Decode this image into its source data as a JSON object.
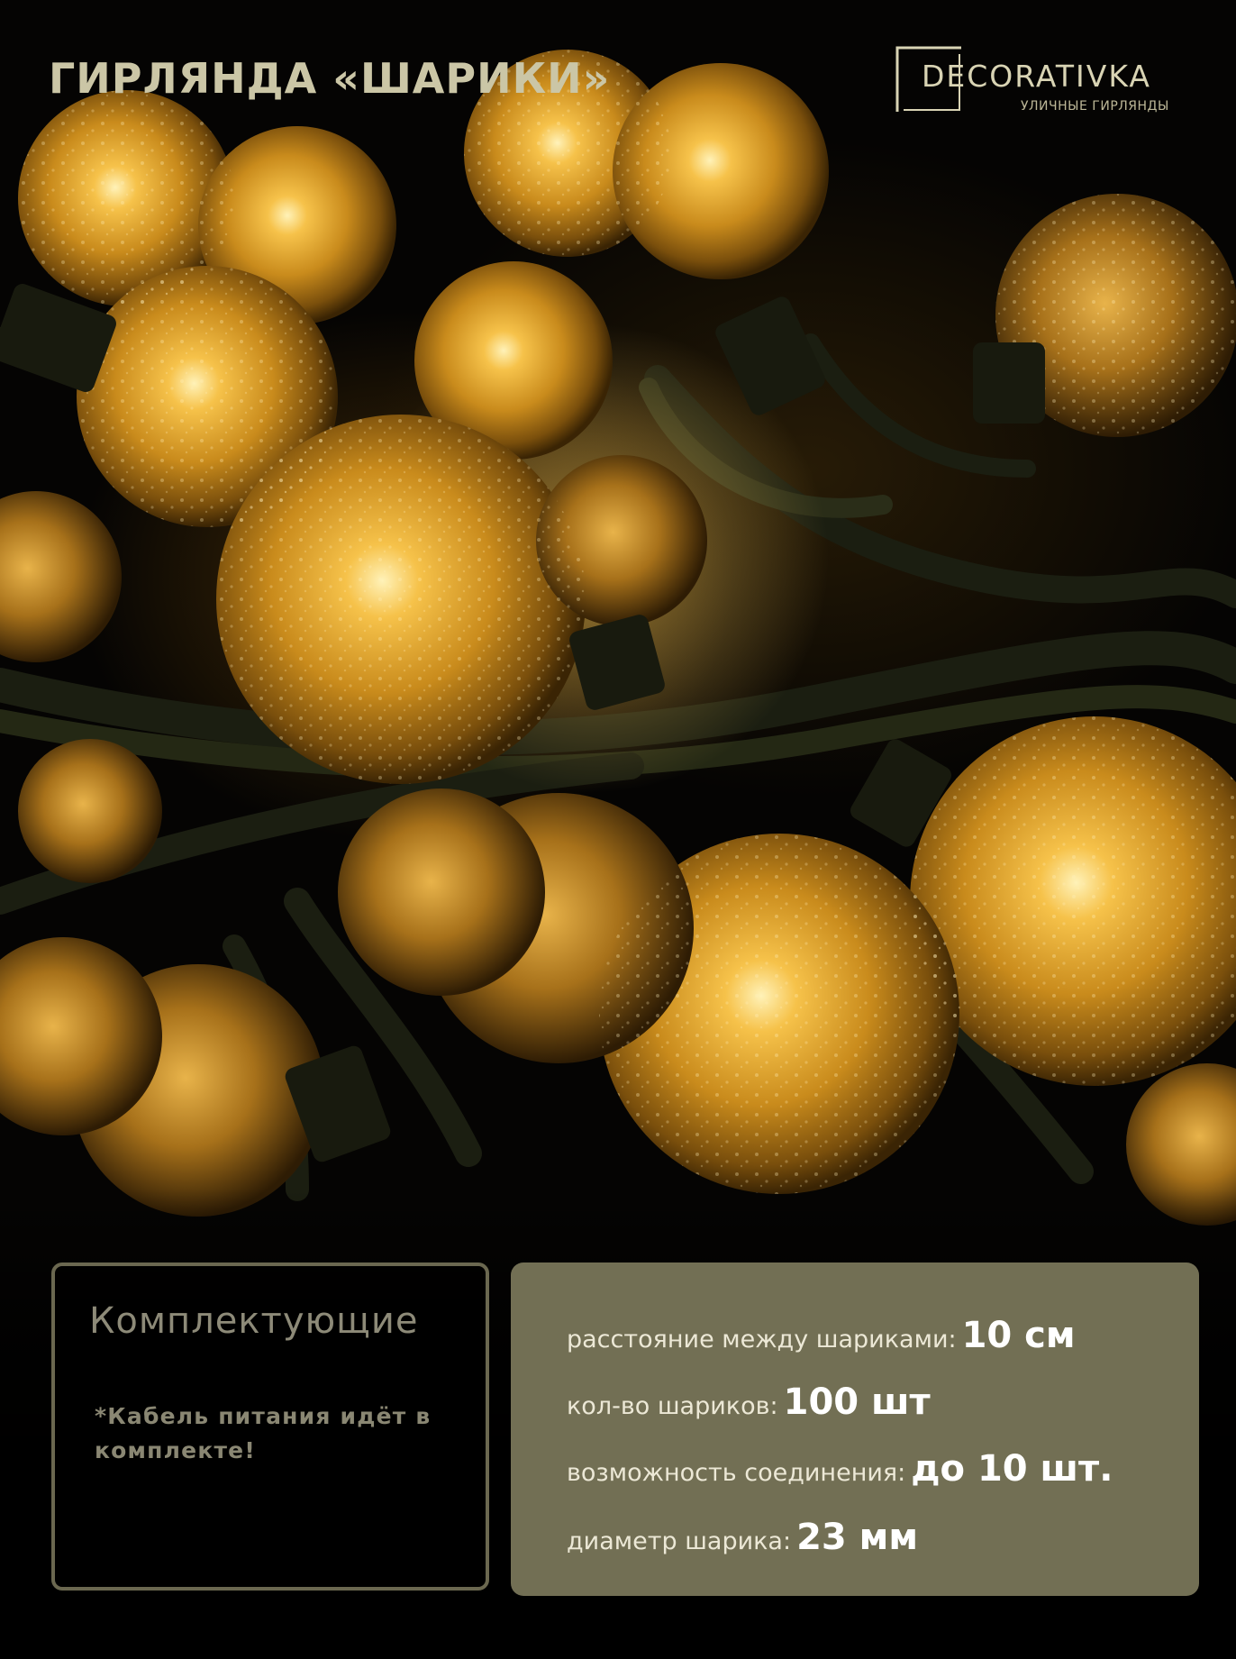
{
  "header": {
    "title": "ГИРЛЯНДА «ШАРИКИ»"
  },
  "logo": {
    "name": "DECORATIVKA",
    "tagline": "УЛИЧНЫЕ ГИРЛЯНДЫ"
  },
  "kit": {
    "title": "Комплектующие",
    "note": "*Кабель питания идёт в комплекте!"
  },
  "specs": [
    {
      "label": "расстояние между шариками:",
      "value": "10 см"
    },
    {
      "label": "кол-во шариков:",
      "value": "100 шт"
    },
    {
      "label": "возможность соединения:",
      "value": "до 10 шт."
    },
    {
      "label": "диаметр шарика:",
      "value": "23 мм"
    }
  ],
  "colors": {
    "title_text": "#cbc6a6",
    "spec_panel": "#726f54",
    "kit_border": "#6b6850",
    "bulb_glow": "#f2b63a",
    "wire": "#1a1d10"
  },
  "photo": {
    "subject": "garland-bulbs"
  }
}
